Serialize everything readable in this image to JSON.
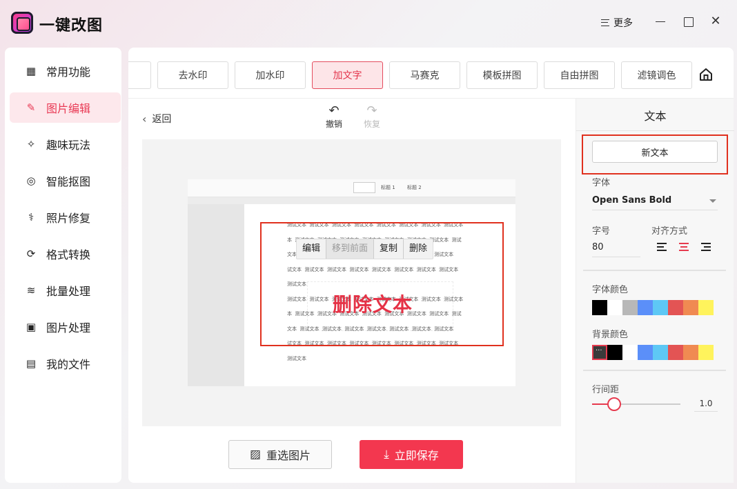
{
  "app": {
    "title": "一键改图",
    "more_label": "更多",
    "close_glyph": "✕"
  },
  "sidebar": {
    "items": [
      {
        "label": "常用功能",
        "icon": "grid-icon",
        "glyph": "▦",
        "active": false
      },
      {
        "label": "图片编辑",
        "icon": "edit-icon",
        "glyph": "✎",
        "active": true
      },
      {
        "label": "趣味玩法",
        "icon": "sparkle-icon",
        "glyph": "✧",
        "active": false
      },
      {
        "label": "智能抠图",
        "icon": "target-icon",
        "glyph": "◎",
        "active": false
      },
      {
        "label": "照片修复",
        "icon": "repair-icon",
        "glyph": "⚕",
        "active": false
      },
      {
        "label": "格式转换",
        "icon": "convert-icon",
        "glyph": "⟳",
        "active": false
      },
      {
        "label": "批量处理",
        "icon": "layers-icon",
        "glyph": "≋",
        "active": false
      },
      {
        "label": "图片处理",
        "icon": "image-icon",
        "glyph": "▣",
        "active": false
      },
      {
        "label": "我的文件",
        "icon": "file-icon",
        "glyph": "▤",
        "active": false
      }
    ]
  },
  "tabs": [
    {
      "label": "去水印",
      "active": false
    },
    {
      "label": "加水印",
      "active": false
    },
    {
      "label": "加文字",
      "active": true
    },
    {
      "label": "马赛克",
      "active": false
    },
    {
      "label": "模板拼图",
      "active": false
    },
    {
      "label": "自由拼图",
      "active": false
    },
    {
      "label": "滤镜调色",
      "active": false
    }
  ],
  "toolbar": {
    "back_label": "返回",
    "undo_label": "撤销",
    "redo_label": "恢复"
  },
  "document": {
    "ribbon_style_1": "标题 1",
    "ribbon_style_2": "标题 2",
    "lines": [
      "测试文本  测试文本  测试文本  测试文本  测试文本  测试文本  测试文本  测试文本",
      "本  测试文本  测试文本  测试文本  测试文本  测试文本  测试文本  测试文本  测试",
      "文本  测试文本  测试文本  测试文本  测试文本  测试文本  测试文本  测试文本",
      "试文本  测试文本  测试文本  测试文本  测试文本  测试文本  测试文本  测试文本",
      "测试文本",
      "测试文本  测试文本  测试文本  测试文本  测试文本  测试文本  测试文本  测试文本",
      "本  测试文本  测试文本  测试文本  测试文本  测试文本  测试文本  测试文本  测试",
      "文本  测试文本  测试文本  测试文本  测试文本  测试文本  测试文本  测试文本",
      "试文本  测试文本  测试文本  测试文本  测试文本  测试文本  测试文本  测试文本",
      "测试文本"
    ],
    "context_menu": {
      "edit": "编辑",
      "bring_front": "移到前面",
      "copy": "复制",
      "delete": "删除"
    },
    "overlay_text": "删除文本",
    "overlay_color": "#e53246"
  },
  "actions": {
    "reselect_label": "重选图片",
    "save_label": "立即保存"
  },
  "panel": {
    "title": "文本",
    "new_text_label": "新文本",
    "font_label": "字体",
    "font_value": "Open Sans Bold",
    "size_label": "字号",
    "size_value": "80",
    "align_label": "对齐方式",
    "align_selected": "center",
    "font_color_label": "字体颜色",
    "font_colors": [
      "#000000",
      "#ffffff",
      "#b8b8b8",
      "#5b8ff9",
      "#5ec8f5",
      "#e35454",
      "#f08a52",
      "#fff35c"
    ],
    "bg_color_label": "背景颜色",
    "bg_colors": [
      "#3a3a3a",
      "#000000",
      "#ffffff",
      "#5b8ff9",
      "#5ec8f5",
      "#e35454",
      "#f08a52",
      "#fff35c"
    ],
    "line_height_label": "行间距",
    "line_height_value": "1.0",
    "line_height_fraction": 0.25,
    "accent": "#f3374f"
  }
}
